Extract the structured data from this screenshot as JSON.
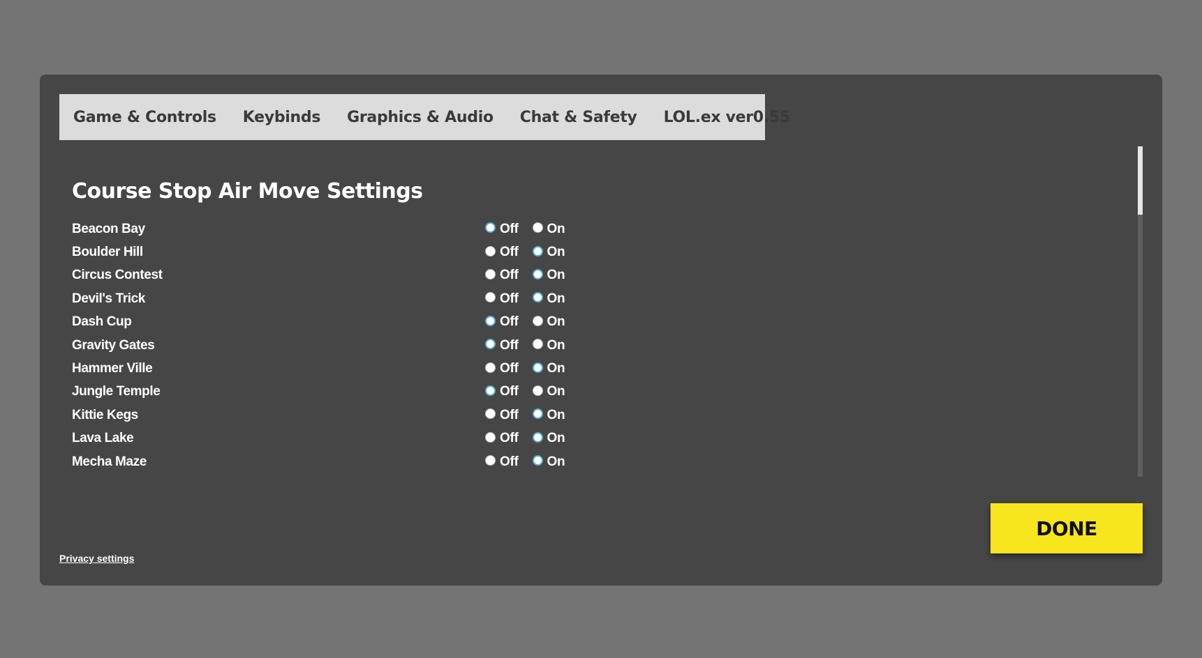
{
  "tabs": [
    {
      "label": "Game & Controls"
    },
    {
      "label": "Keybinds"
    },
    {
      "label": "Graphics & Audio"
    },
    {
      "label": "Chat & Safety"
    },
    {
      "label": "LOL.ex ver0.55"
    }
  ],
  "section": {
    "title": "Course Stop Air Move Settings",
    "off_label": "Off",
    "on_label": "On"
  },
  "courses": [
    {
      "name": "Beacon Bay",
      "value": "Off"
    },
    {
      "name": "Boulder Hill",
      "value": "On"
    },
    {
      "name": "Circus Contest",
      "value": "On"
    },
    {
      "name": "Devil's Trick",
      "value": "On"
    },
    {
      "name": "Dash Cup",
      "value": "Off"
    },
    {
      "name": "Gravity Gates",
      "value": "Off"
    },
    {
      "name": "Hammer Ville",
      "value": "On"
    },
    {
      "name": "Jungle Temple",
      "value": "Off"
    },
    {
      "name": "Kittie Kegs",
      "value": "On"
    },
    {
      "name": "Lava Lake",
      "value": "On"
    },
    {
      "name": "Mecha Maze",
      "value": "On"
    }
  ],
  "footer": {
    "privacy_label": "Privacy settings",
    "done_label": "DONE"
  },
  "colors": {
    "background": "#747474",
    "dialog": "#464646",
    "tabbar": "#dcdcdc",
    "radio_selected_ring": "#55b0d8",
    "done_button": "#f7e51d"
  }
}
